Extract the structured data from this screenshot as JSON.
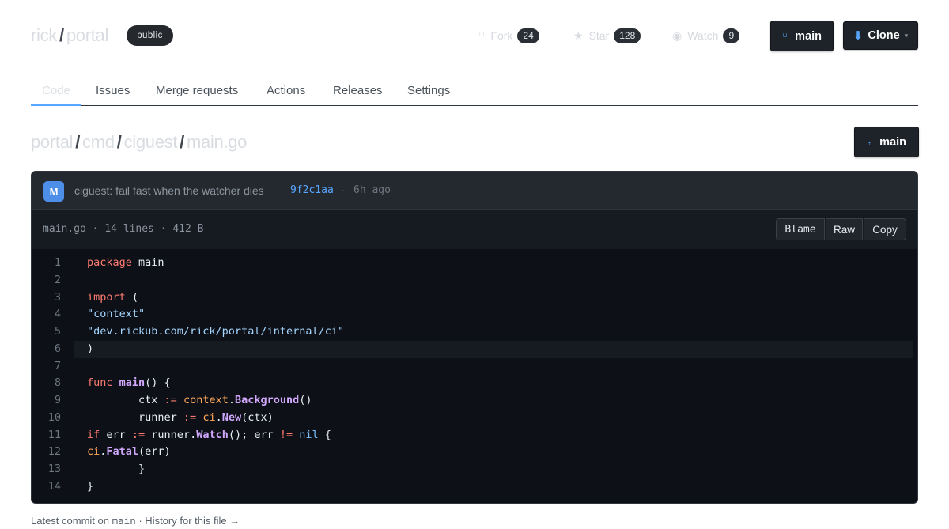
{
  "repo": {
    "owner": "rick",
    "separator": "/",
    "name": "portal",
    "visibility": "public"
  },
  "stats": {
    "fork_label": "Fork",
    "fork_count": "24",
    "star_label": "Star",
    "star_count": "128",
    "watch_label": "Watch",
    "watch_count": "9"
  },
  "actions": {
    "branch_label": "main",
    "clone_label": "Clone"
  },
  "tabs": [
    {
      "label": "Code",
      "active": true
    },
    {
      "label": "Issues"
    },
    {
      "label": "Merge requests"
    },
    {
      "label": "Actions"
    },
    {
      "label": "Releases"
    },
    {
      "label": "Settings"
    }
  ],
  "path": {
    "parts": [
      "portal",
      "cmd",
      "ciguest",
      "main.go"
    ],
    "separator": "/",
    "branch_label": "main"
  },
  "commit": {
    "avatar_initial": "M",
    "message": "ciguest: fail fast when the watcher dies",
    "sha": "9f2c1aa",
    "separator": "·",
    "time": "6h ago"
  },
  "file": {
    "meta": "main.go · 14 lines · 412 B",
    "blame_label": "Blame",
    "raw_label": "Raw",
    "copy_label": "Copy"
  },
  "code": {
    "line_numbers": [
      "1",
      "2",
      "3",
      "4",
      "5",
      "6",
      "7",
      "8",
      "9",
      "10",
      "11",
      "12",
      "13",
      "14"
    ],
    "highlighted_line": 6,
    "lines": [
      "package main",
      "",
      "import (",
      "\"context\"",
      "\"dev.rickub.com/rick/portal/internal/ci\"",
      ")",
      "",
      "func main() {",
      "        ctx := context.Background()",
      "        runner := ci.New(ctx)",
      "if err := runner.Watch(); err != nil {",
      "ci.Fatal(err)",
      "        }",
      "}"
    ]
  },
  "footer": {
    "prefix": "Latest commit on",
    "branch": "main",
    "history_link": "· History for this file →"
  },
  "colors": {
    "accent": "#58a6ff",
    "keyword": "#ff7b72",
    "string": "#a5d6ff",
    "function": "#d2a8ff",
    "package": "#ffa657",
    "code_bg": "#0d1117"
  },
  "icons": {
    "fork": "fork-icon",
    "star": "star-icon",
    "watch": "eye-icon",
    "branch": "branch-icon",
    "clone": "download-arrow-icon"
  }
}
